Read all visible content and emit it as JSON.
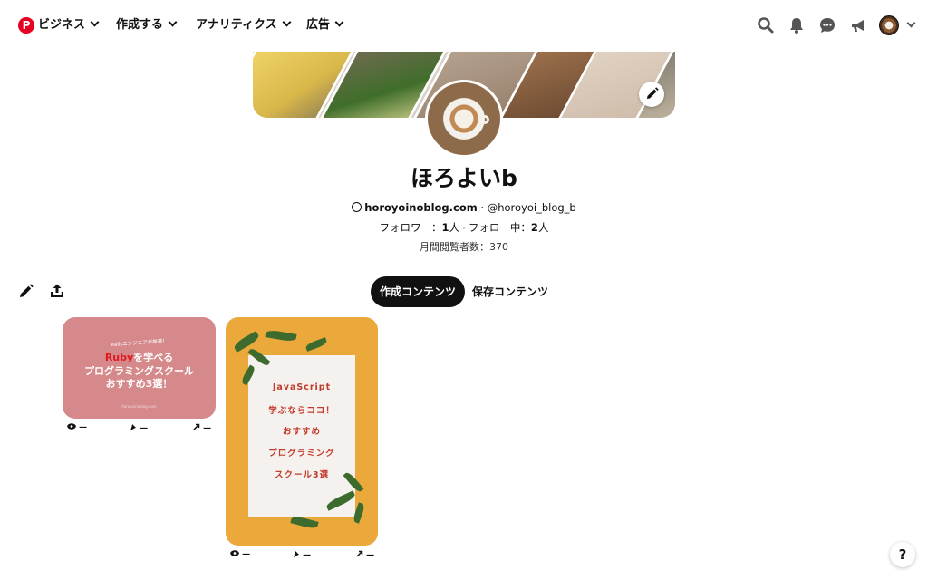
{
  "nav": {
    "logo": "P",
    "items": [
      {
        "label": "ビジネス"
      },
      {
        "label": "作成する"
      },
      {
        "label": "アナリティクス"
      },
      {
        "label": "広告"
      }
    ],
    "icons": [
      "search-icon",
      "bell-icon",
      "chat-icon",
      "megaphone-icon",
      "avatar",
      "chevron-down-icon"
    ]
  },
  "profile": {
    "name": "ほろよいb",
    "website": "horoyoinoblog.com",
    "separator": " · ",
    "handle": "@horoyoi_blog_b",
    "followers_label": "フォロワー：",
    "followers_count": "1",
    "followers_unit": "人",
    "dot": "·",
    "following_label": "フォロー中：",
    "following_count": "2",
    "following_unit": "人",
    "monthly_views": "月間閲覧者数：370"
  },
  "tabs": {
    "created": "作成コンテンツ",
    "saved": "保存コンテンツ"
  },
  "pins": [
    {
      "small_text": "Railsエンジニアが厳選！",
      "ruby": "Ruby",
      "line1_rest": "を学べる",
      "line2": "プログラミングスクール",
      "line3": "おすすめ3選！",
      "url_text": "horoyoinoblog.com",
      "stats": {
        "views": "—",
        "saves": "—",
        "clicks": "—"
      }
    },
    {
      "lines": [
        "JavaScript",
        "学ぶならココ！",
        "おすすめ",
        "プログラミング",
        "スクール3選"
      ],
      "stats": {
        "views": "—",
        "saves": "—",
        "clicks": "—"
      }
    }
  ],
  "help": "?",
  "colors": {
    "brand": "#e60023",
    "pin1_bg": "#d6898b",
    "pin2_bg": "#eaa93a",
    "pin2_text": "#c23a2a"
  }
}
